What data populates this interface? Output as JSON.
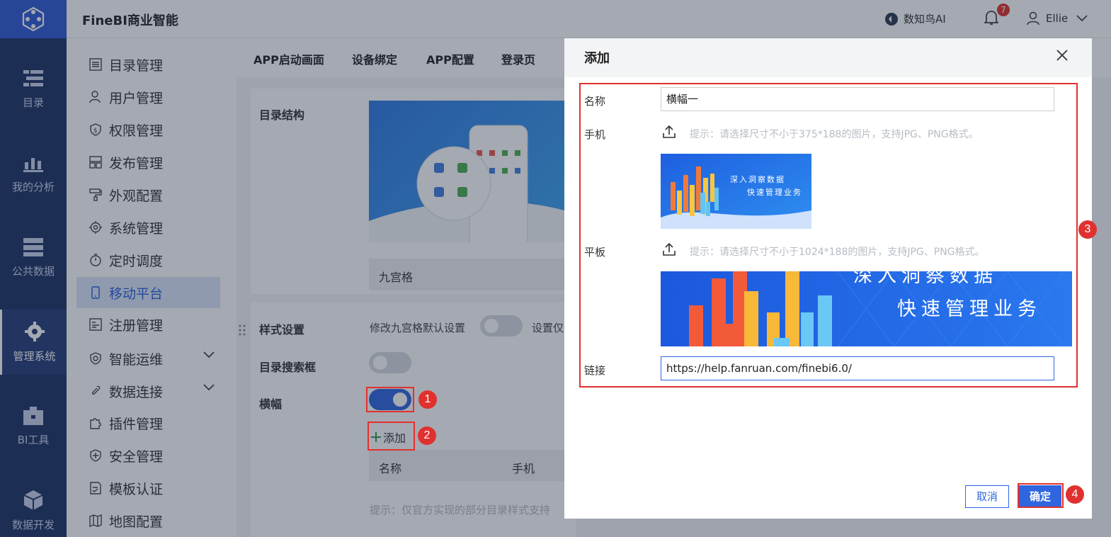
{
  "header": {
    "title": "FineBI商业智能",
    "ai_label": "数知鸟AI",
    "notification_count": "7",
    "username": "Ellie"
  },
  "leftnav": {
    "items": [
      {
        "label": "目录",
        "icon": "catalog-icon"
      },
      {
        "label": "我的分析",
        "icon": "analysis-icon"
      },
      {
        "label": "公共数据",
        "icon": "database-icon"
      },
      {
        "label": "管理系统",
        "icon": "gear-icon",
        "active": true
      },
      {
        "label": "BI工具",
        "icon": "toolbox-icon"
      },
      {
        "label": "数据开发",
        "icon": "cube-icon"
      }
    ]
  },
  "subnav": {
    "items": [
      {
        "label": "目录管理",
        "icon": "list-icon"
      },
      {
        "label": "用户管理",
        "icon": "user-icon"
      },
      {
        "label": "权限管理",
        "icon": "shield-icon"
      },
      {
        "label": "发布管理",
        "icon": "publish-icon"
      },
      {
        "label": "外观配置",
        "icon": "paint-roller-icon"
      },
      {
        "label": "系统管理",
        "icon": "gear-icon"
      },
      {
        "label": "定时调度",
        "icon": "timer-icon"
      },
      {
        "label": "移动平台",
        "icon": "mobile-icon",
        "active": true
      },
      {
        "label": "注册管理",
        "icon": "register-icon"
      },
      {
        "label": "智能运维",
        "icon": "ops-icon",
        "expandable": true
      },
      {
        "label": "数据连接",
        "icon": "link-icon",
        "expandable": true
      },
      {
        "label": "插件管理",
        "icon": "puzzle-icon"
      },
      {
        "label": "安全管理",
        "icon": "security-icon"
      },
      {
        "label": "模板认证",
        "icon": "template-cert-icon"
      },
      {
        "label": "地图配置",
        "icon": "map-icon"
      }
    ]
  },
  "tabs": [
    "APP启动画面",
    "设备绑定",
    "APP配置",
    "登录页"
  ],
  "page": {
    "catalog_structure_label": "目录结构",
    "grid_style_value": "九宫格",
    "style_settings_label": "样式设置",
    "style_settings_text": "修改九宫格默认设置",
    "style_settings_text2": "设置仅",
    "search_box_label": "目录搜索框",
    "banner_label": "横幅",
    "add_label": "添加",
    "table_headers": [
      "名称",
      "手机"
    ],
    "hint_text": "提示：仅官方实现的部分目录样式支持"
  },
  "modal": {
    "title": "添加",
    "name_label": "名称",
    "name_value": "横幅一",
    "phone_label": "手机",
    "phone_hint": "提示：请选择尺寸不小于375*188的图片，支持JPG、PNG格式。",
    "tablet_label": "平板",
    "tablet_hint": "提示：请选择尺寸不小于1024*188的图片，支持JPG、PNG格式。",
    "banner_line1": "深入洞察数据",
    "banner_line2": "快速管理业务",
    "link_label": "链接",
    "link_value": "https://help.fanruan.com/finebi6.0/",
    "cancel_label": "取消",
    "confirm_label": "确定"
  },
  "annotations": [
    "1",
    "2",
    "3",
    "4"
  ],
  "colors": {
    "accent": "#2f66e0",
    "nav_bg": "#1d3266",
    "annotation": "#e0312f"
  }
}
